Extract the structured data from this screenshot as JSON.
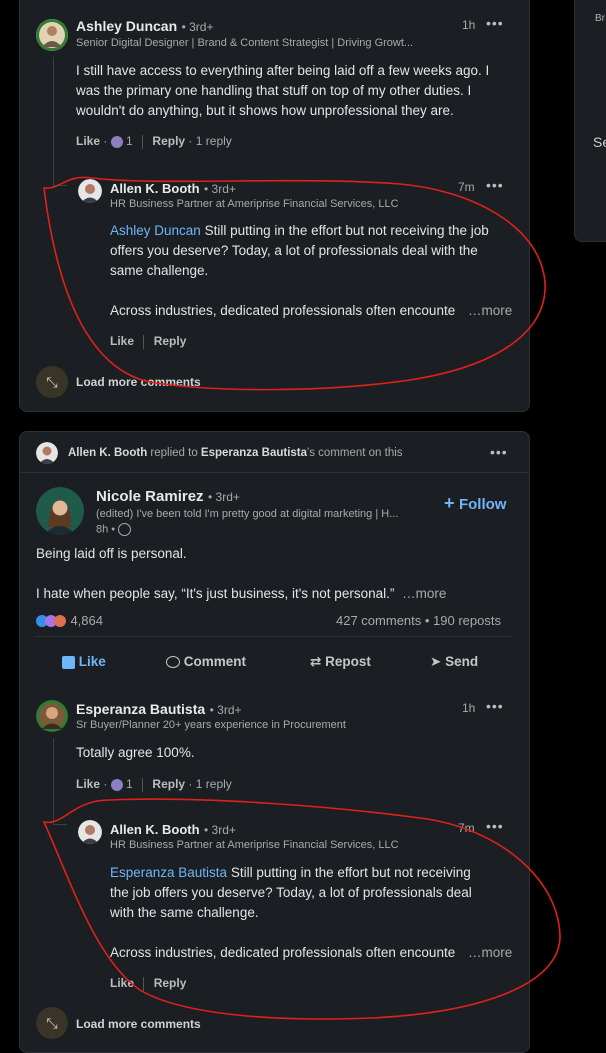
{
  "right_panel": {
    "top_fragment": "Br",
    "mid_fragment": "Se"
  },
  "card1": {
    "comment": {
      "name": "Ashley Duncan",
      "degree": "• 3rd+",
      "headline": "Senior Digital Designer | Brand & Content Strategist | Driving Growt...",
      "time": "1h",
      "text": "I still have access to everything after being laid off a few weeks ago. I was the primary one handling that stuff on top of my other duties. I wouldn't do anything, but it shows how unprofessional they are.",
      "like_label": "Like",
      "reaction_count": "1",
      "reply_label": "Reply",
      "reply_count": "1 reply"
    },
    "reply": {
      "name": "Allen K. Booth",
      "degree": "• 3rd+",
      "headline": "HR Business Partner at Ameriprise Financial Services, LLC",
      "time": "7m",
      "mention": "Ashley Duncan",
      "text_line1": " Still putting in the effort but not receiving the job",
      "text_line2": "offers you deserve? Today, a lot of professionals deal with the",
      "text_line3": "same challenge.",
      "text_line4": "Across industries, dedicated professionals often encounte",
      "more_label": "…more",
      "like_label": "Like",
      "reply_label": "Reply"
    },
    "load_more": "Load more comments"
  },
  "card2": {
    "context": {
      "actor": "Allen K. Booth",
      "middle": " replied to ",
      "target": "Esperanza Bautista",
      "suffix": "'s comment on this"
    },
    "post": {
      "name": "Nicole Ramirez",
      "degree": "• 3rd+",
      "headline": "(edited) I've been told I'm pretty good at digital marketing | H...",
      "time": "8h •",
      "follow_label": "Follow",
      "text_line1": "Being laid off is personal.",
      "text_line2": "I hate when people say, “It's just business, it's not personal.”",
      "more_label": "…more",
      "reaction_count": "4,864",
      "comments": "427 comments",
      "reposts": "190 reposts",
      "stats_sep": " • "
    },
    "action_bar": {
      "like": "Like",
      "comment": "Comment",
      "repost": "Repost",
      "send": "Send"
    },
    "comment": {
      "name": "Esperanza Bautista",
      "degree": "• 3rd+",
      "headline": "Sr Buyer/Planner 20+ years experience in Procurement",
      "time": "1h",
      "text": "Totally agree 100%.",
      "like_label": "Like",
      "reaction_count": "1",
      "reply_label": "Reply",
      "reply_count": "1 reply"
    },
    "reply": {
      "name": "Allen K. Booth",
      "degree": "• 3rd+",
      "headline": "HR Business Partner at Ameriprise Financial Services, LLC",
      "time": "7m",
      "mention": "Esperanza Bautista",
      "text_line1": " Still putting in the effort but not receiving",
      "text_line2": "the job offers you deserve? Today, a lot of professionals deal",
      "text_line3": "with the same challenge.",
      "text_line4": "Across industries, dedicated professionals often encounte",
      "more_label": "…more",
      "like_label": "Like",
      "reply_label": "Reply"
    },
    "load_more": "Load more comments"
  },
  "colors": {
    "background": "#000000",
    "card": "#1b1f23",
    "accent": "#70b5f9",
    "annotation": "#e0201a"
  }
}
